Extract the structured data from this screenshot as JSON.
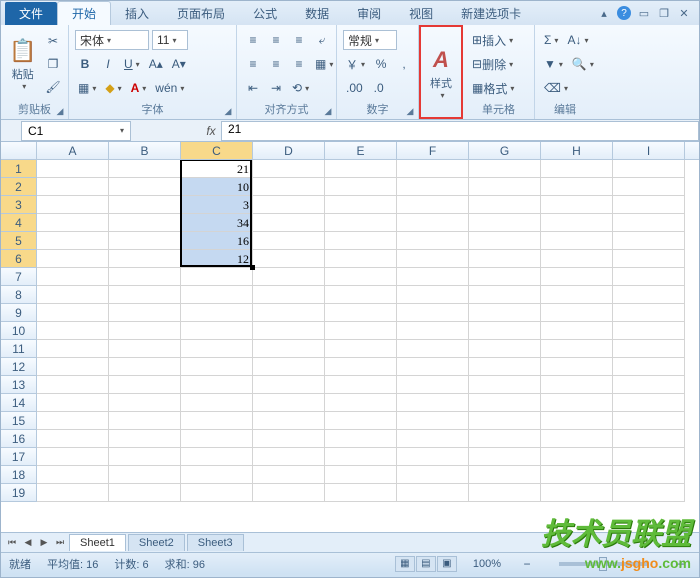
{
  "tabs": {
    "file": "文件",
    "home": "开始",
    "insert": "插入",
    "layout": "页面布局",
    "formulas": "公式",
    "data": "数据",
    "review": "审阅",
    "view": "视图",
    "custom": "新建选项卡"
  },
  "ribbon": {
    "clipboard": {
      "label": "剪贴板",
      "paste": "粘贴"
    },
    "font": {
      "label": "字体",
      "name": "宋体",
      "size": "11"
    },
    "align": {
      "label": "对齐方式"
    },
    "number": {
      "label": "数字",
      "format": "常规"
    },
    "styles": {
      "label": "样式",
      "btn": "样式"
    },
    "cells": {
      "label": "单元格",
      "insert": "插入",
      "delete": "删除",
      "format": "格式"
    },
    "editing": {
      "label": "编辑"
    }
  },
  "namebox": "C1",
  "formula": "21",
  "columns": [
    "A",
    "B",
    "C",
    "D",
    "E",
    "F",
    "G",
    "H",
    "I"
  ],
  "rows_visible": 19,
  "cell_data": {
    "C1": "21",
    "C2": "10",
    "C3": "3",
    "C4": "34",
    "C5": "16",
    "C6": "12"
  },
  "selection": {
    "col": "C",
    "row_start": 1,
    "row_end": 6
  },
  "sheets": [
    "Sheet1",
    "Sheet2",
    "Sheet3"
  ],
  "active_sheet": 0,
  "status": {
    "ready": "就绪",
    "avg_label": "平均值:",
    "avg": "16",
    "count_label": "计数:",
    "count": "6",
    "sum_label": "求和:",
    "sum": "96",
    "zoom": "100%"
  },
  "watermark": {
    "text": "技术员联盟",
    "url_p1": "www.",
    "url_p2": "jsgho",
    "url_p3": ".com"
  }
}
